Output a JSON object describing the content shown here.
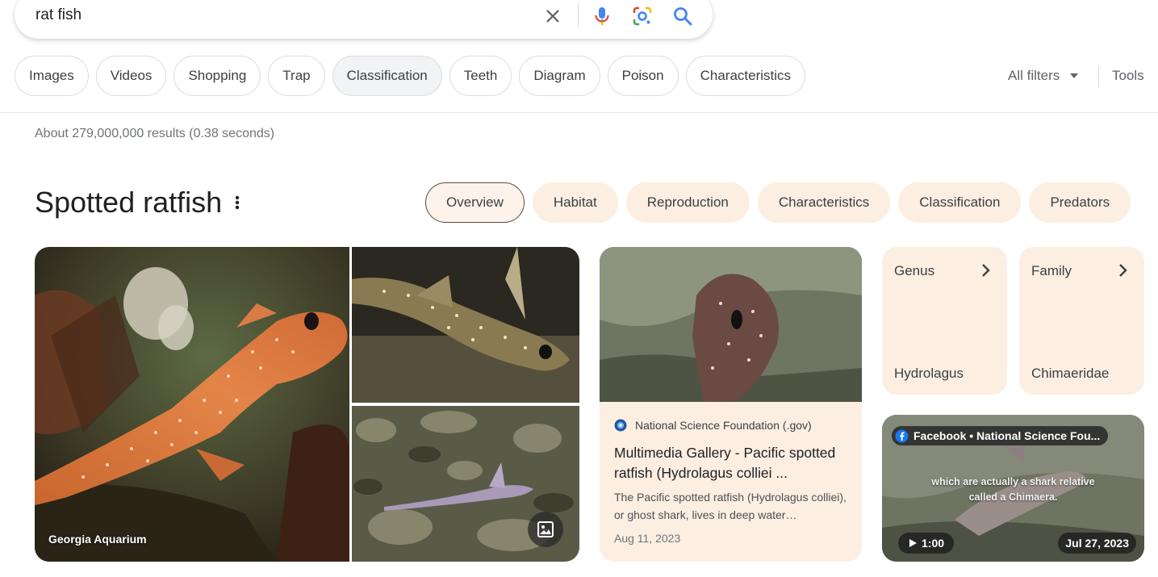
{
  "search": {
    "query": "rat fish"
  },
  "filter_chips": [
    "Images",
    "Videos",
    "Shopping",
    "Trap",
    "Classification",
    "Teeth",
    "Diagram",
    "Poison",
    "Characteristics"
  ],
  "active_chip": "Classification",
  "all_filters_label": "All filters",
  "tools_label": "Tools",
  "result_stats": "About 279,000,000 results (0.38 seconds)",
  "knowledge_panel": {
    "title": "Spotted ratfish",
    "tabs": [
      "Overview",
      "Habitat",
      "Reproduction",
      "Characteristics",
      "Classification",
      "Predators"
    ],
    "active_tab": "Overview",
    "main_image_caption": "Georgia Aquarium",
    "article": {
      "source": "National Science Foundation (.gov)",
      "title": "Multimedia Gallery - Pacific spotted ratfish (Hydrolagus colliei ...",
      "snippet": "The Pacific spotted ratfish (Hydrolagus colliei), or ghost shark, lives in deep water…",
      "date": "Aug 11, 2023"
    },
    "facts": [
      {
        "label": "Genus",
        "value": "Hydrolagus"
      },
      {
        "label": "Family",
        "value": "Chimaeridae"
      }
    ],
    "video": {
      "source": "Facebook • National Science Fou...",
      "caption_line1": "which are actually a shark relative",
      "caption_line2": "called a Chimaera.",
      "duration": "1:00",
      "date": "Jul 27, 2023"
    }
  },
  "colors": {
    "tab_bg": "#fdeee2",
    "chip_border": "#dadce0",
    "google_blue": "#4285f4"
  }
}
